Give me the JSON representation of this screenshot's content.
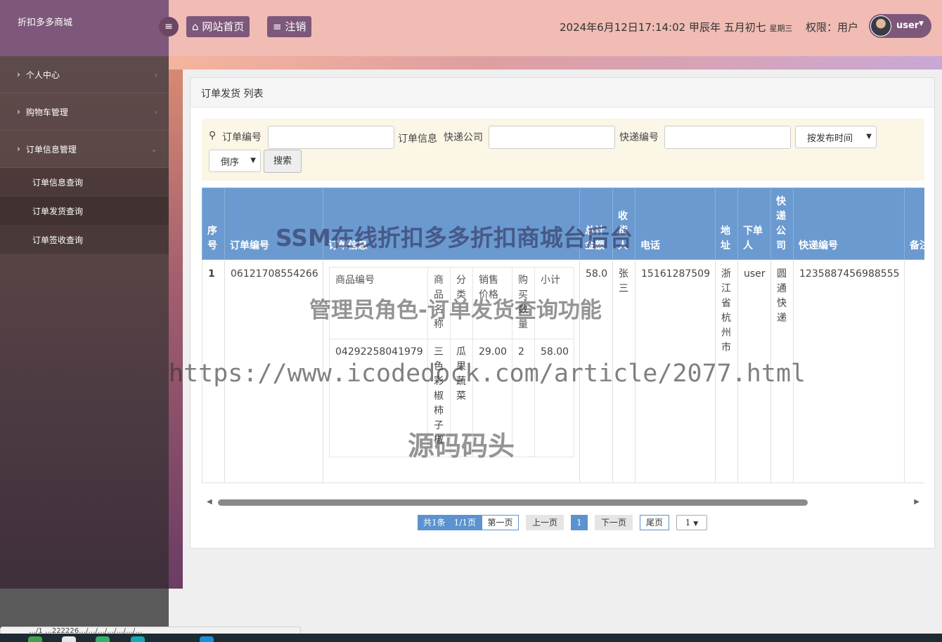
{
  "sidebar": {
    "brand": "折扣多多商城",
    "menus": [
      {
        "label": "个人中心"
      },
      {
        "label": "购物车管理"
      },
      {
        "label": "订单信息管理"
      }
    ],
    "submenu": [
      {
        "label": "订单信息查询"
      },
      {
        "label": "订单发货查询"
      },
      {
        "label": "订单签收查询"
      }
    ]
  },
  "topbar": {
    "home_label": "网站首页",
    "logout_label": "注销",
    "datetime": "2024年6月12日17:14:02 甲辰年 五月初七",
    "weekday": "星期三",
    "permission": "权限：用户",
    "username": "user"
  },
  "panel": {
    "title": "订单发货 列表"
  },
  "search": {
    "order_no_label": "订单编号",
    "order_info_label": "订单信息",
    "express_company_label": "快递公司",
    "express_no_label": "快递编号",
    "sort_field": "按发布时间",
    "sort_order": "倒序",
    "search_button": "搜索"
  },
  "table": {
    "headers": [
      "序号",
      "订单编号",
      "订单信息",
      "总计金额",
      "收货人",
      "电话",
      "地址",
      "下单人",
      "快递公司",
      "快递编号",
      "备注"
    ],
    "rows": [
      {
        "index": "1",
        "order_no": "06121708554266",
        "total": "58.0",
        "receiver": "张三",
        "phone": "15161287509",
        "address": "浙江省杭州市",
        "orderer": "user",
        "express_company": "圆通快递",
        "express_no": "1235887456988555",
        "remark": "",
        "items": {
          "headers": [
            "商品编号",
            "商品名称",
            "分类",
            "销售价格",
            "购买数量",
            "小计"
          ],
          "rows": [
            {
              "product_no": "04292258041979",
              "name": "三色彩椒柿子椒",
              "category": "瓜果蔬菜",
              "price": "29.00",
              "qty": "2",
              "subtotal": "58.00"
            }
          ]
        }
      }
    ]
  },
  "pagination": {
    "info": "共1条　1/1页",
    "first": "第一页",
    "prev": "上一页",
    "current": "1",
    "next": "下一页",
    "last": "尾页",
    "page_select": "1"
  },
  "watermarks": {
    "title": "SSM在线折扣多多折扣商城台后台",
    "subtitle": "管理员角色-订单发货查询功能",
    "url": "https://www.icodedock.com/article/2077.html",
    "brand": "源码码头"
  },
  "statusbar": {
    "text": "…/1 …222226…/…/…/…/…/…/…"
  }
}
